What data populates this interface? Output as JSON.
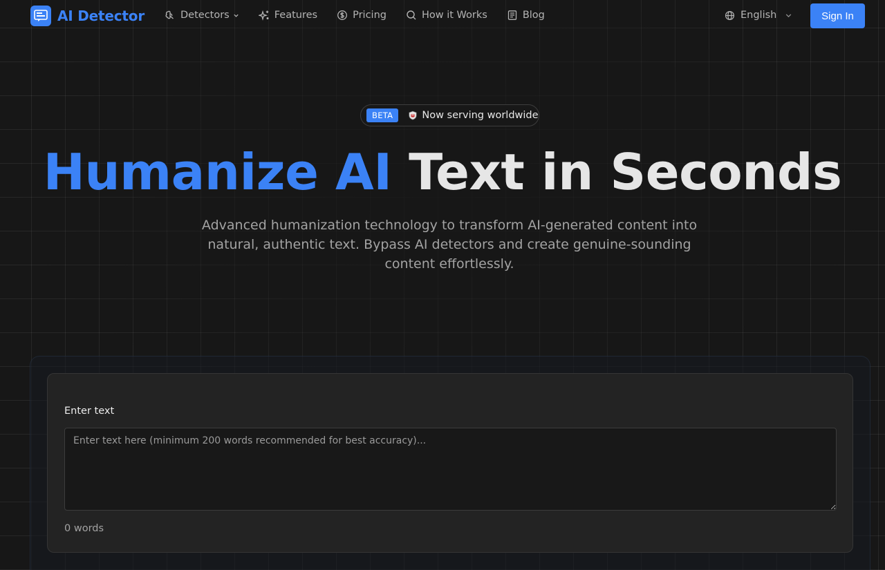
{
  "nav": {
    "brand": "AI Detector",
    "links": [
      {
        "label": "Detectors",
        "icon": "brain-icon",
        "dropdown": true
      },
      {
        "label": "Features",
        "icon": "sparkles-icon"
      },
      {
        "label": "Pricing",
        "icon": "dollar-circle-icon"
      },
      {
        "label": "How it Works",
        "icon": "search-icon"
      },
      {
        "label": "Blog",
        "icon": "document-icon"
      }
    ],
    "language": "English",
    "signin_label": "Sign In"
  },
  "hero": {
    "badge_tag": "BETA",
    "badge_text": "Now serving worldwide",
    "title_accent": "Humanize AI",
    "title_rest": "Text in Seconds",
    "subtitle": "Advanced humanization technology to transform AI-generated content into natural, authentic text. Bypass AI detectors and create genuine-sounding content effortlessly."
  },
  "editor": {
    "label": "Enter text",
    "placeholder": "Enter text here (minimum 200 words recommended for best accuracy)...",
    "value": "",
    "word_count": "0 words"
  },
  "colors": {
    "accent": "#3b82f6",
    "background": "#171717",
    "card": "#232323"
  }
}
